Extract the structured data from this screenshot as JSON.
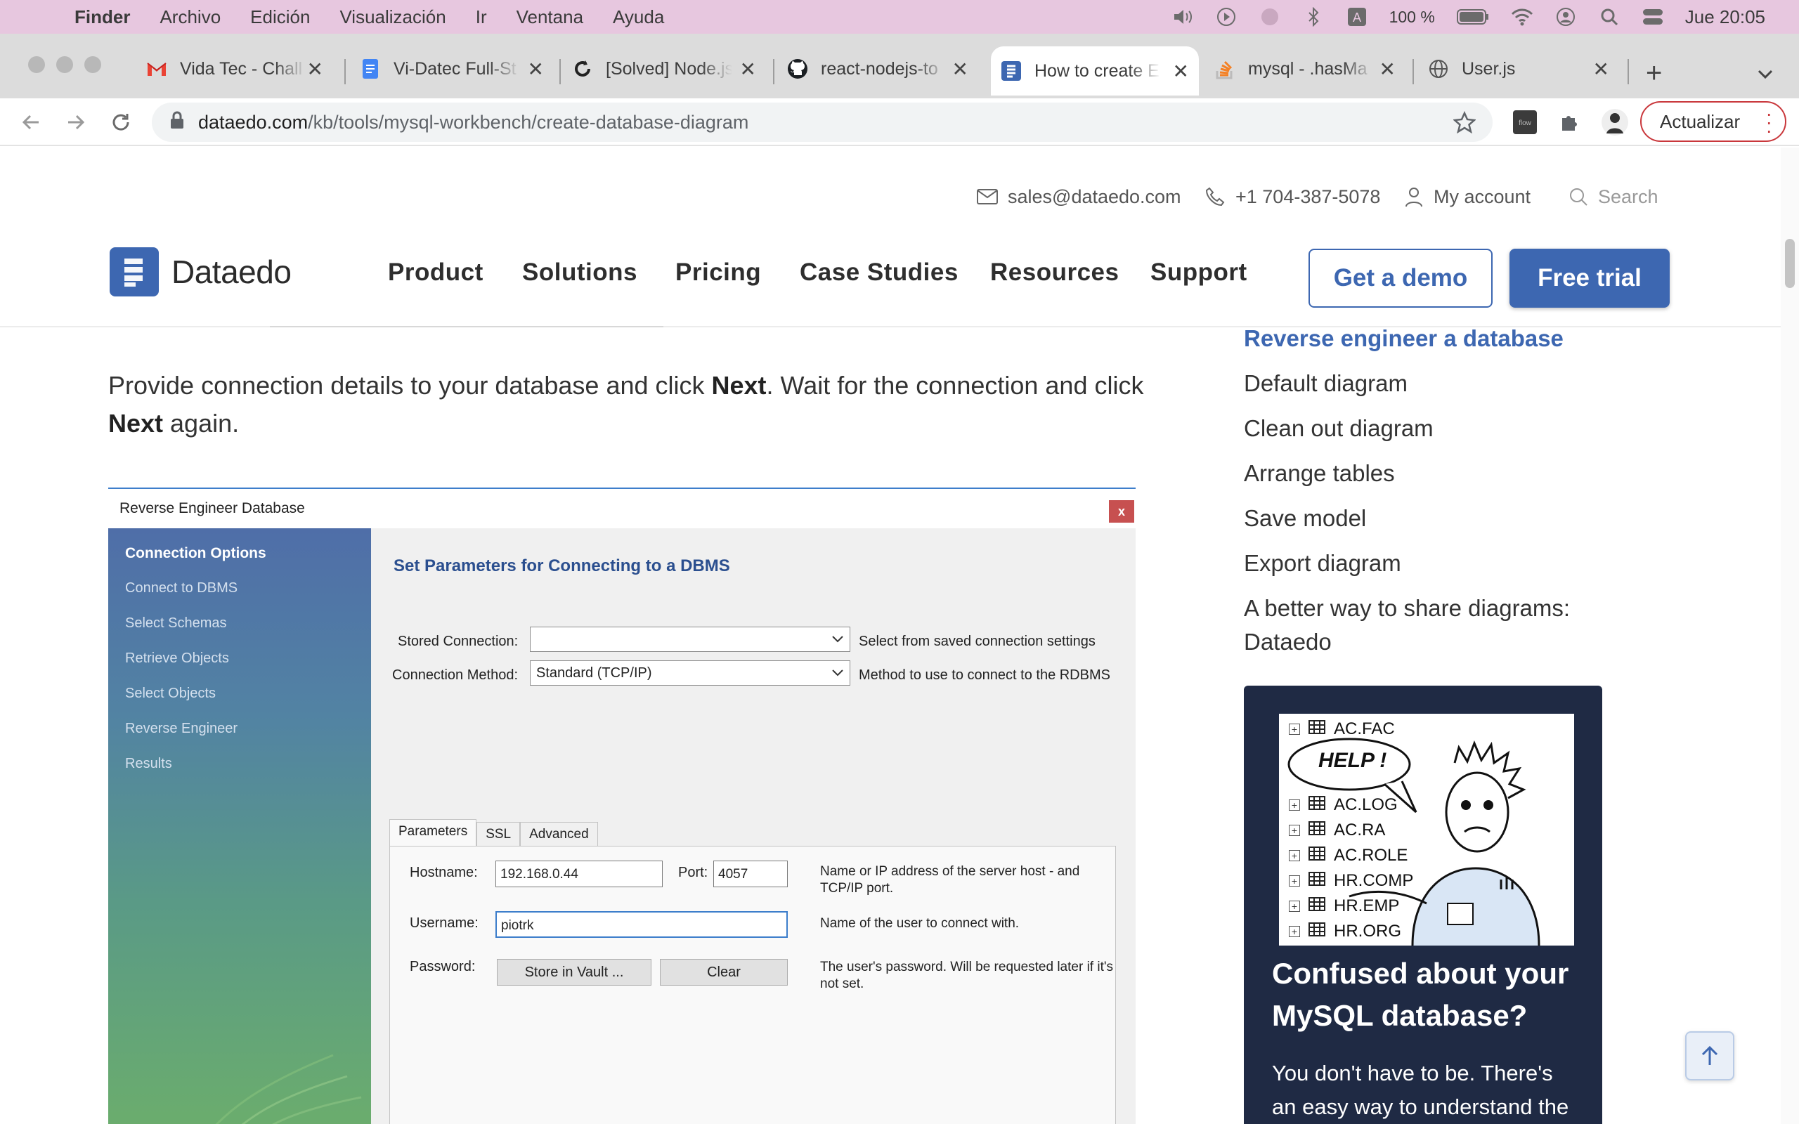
{
  "menubar": {
    "app": "Finder",
    "items": [
      "Archivo",
      "Edición",
      "Visualización",
      "Ir",
      "Ventana",
      "Ayuda"
    ],
    "battery": "100 %",
    "clock": "Jue 20:05"
  },
  "tabs": [
    {
      "title": "Vida Tec - Chall",
      "icon": "gmail-icon"
    },
    {
      "title": "Vi-Datec Full-St",
      "icon": "docs-icon"
    },
    {
      "title": "[Solved] Node.js",
      "icon": "refresh-site-icon"
    },
    {
      "title": "react-nodejs-to",
      "icon": "github-icon"
    },
    {
      "title": "How to create E",
      "icon": "dataedo-favicon"
    },
    {
      "title": "mysql - .hasMa",
      "icon": "stackoverflow-icon"
    },
    {
      "title": "User.js",
      "icon": "globe-icon"
    }
  ],
  "address": {
    "host": "dataedo.com",
    "path": "/kb/tools/mysql-workbench/create-database-diagram"
  },
  "update_label": "Actualizar",
  "topinfo": {
    "email": "sales@dataedo.com",
    "phone": "+1 704-387-5078",
    "account": "My account",
    "search": "Search"
  },
  "header": {
    "logo": "Dataedo",
    "nav": [
      "Product",
      "Solutions",
      "Pricing",
      "Case Studies",
      "Resources",
      "Support"
    ],
    "demo": "Get a demo",
    "trial": "Free trial"
  },
  "intro": {
    "a": "Provide connection details to your database and click ",
    "b": "Next",
    "c": ". Wait for the connection and click ",
    "d": "Next",
    "e": " again."
  },
  "dialog": {
    "title": "Reverse Engineer Database",
    "close": "x",
    "steps": [
      "Connection Options",
      "Connect to DBMS",
      "Select Schemas",
      "Retrieve Objects",
      "Select Objects",
      "Reverse Engineer",
      "Results"
    ],
    "heading": "Set Parameters for Connecting to a DBMS",
    "stored_label": "Stored Connection:",
    "stored_value": "",
    "stored_help": "Select from saved connection settings",
    "method_label": "Connection Method:",
    "method_value": "Standard (TCP/IP)",
    "method_help": "Method to use to connect to the RDBMS",
    "tabs": [
      "Parameters",
      "SSL",
      "Advanced"
    ],
    "hostname_label": "Hostname:",
    "hostname_value": "192.168.0.44",
    "port_label": "Port:",
    "port_value": "4057",
    "hostname_help": "Name or IP address of the server host - and TCP/IP port.",
    "username_label": "Username:",
    "username_value": "piotrk",
    "username_help": "Name of the user to connect with.",
    "password_label": "Password:",
    "vault_btn": "Store in Vault ...",
    "clear_btn": "Clear",
    "password_help": "The user's password. Will be requested later if it's not set."
  },
  "toc": [
    "Reverse engineer a database",
    "Default diagram",
    "Clean out diagram",
    "Arrange tables",
    "Save model",
    "Export diagram",
    "A better way to share diagrams:",
    "Dataedo"
  ],
  "promo": {
    "bubble": "HELP !",
    "tables": [
      "AC.FAC",
      "AC.LOG",
      "AC.RA",
      "AC.ROLE",
      "HR.COMP",
      "HR.EMP",
      "HR.ORG"
    ],
    "title": "Confused about your MySQL database?",
    "body": "You don't have to be. There's an easy way to understand the"
  },
  "colors": {
    "brand": "#3d67b1",
    "promo_bg": "#1f2a44",
    "menubar": "#e7c7df"
  }
}
